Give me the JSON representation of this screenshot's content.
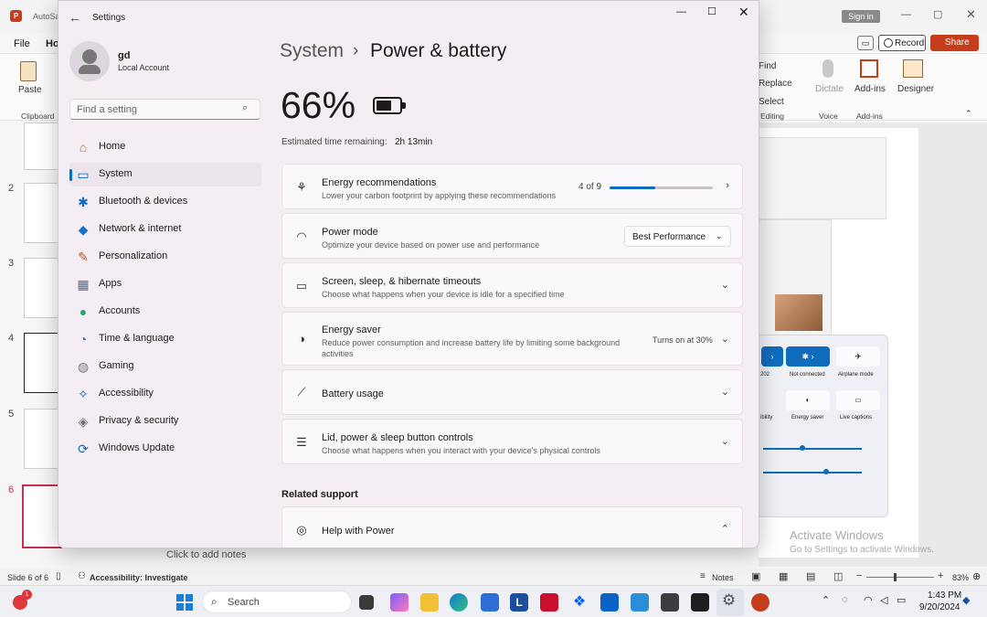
{
  "ppt": {
    "title_small": "AutoSave",
    "signin": "Sign in",
    "record": "Record",
    "share": "Share",
    "menu_file": "File",
    "menu_home": "Ho",
    "paste": "Paste",
    "clipboard": "Clipboard",
    "find": "Find",
    "replace": "Replace",
    "select": "Select",
    "editing": "Editing",
    "dictate": "Dictate",
    "voice": "Voice",
    "addins": "Add-ins",
    "addins_grp": "Add-ins",
    "designer": "Designer",
    "slide_numbers": [
      "2",
      "3",
      "4",
      "5",
      "6"
    ],
    "notes_placeholder": "Click to add notes",
    "status_slide": "Slide 6 of 6",
    "status_access": "Accessibility: Investigate",
    "notes_btn": "Notes",
    "zoom": "83%",
    "activate_title": "Activate Windows",
    "activate_sub": "Go to Settings to activate Windows.",
    "qs": {
      "not_connected": "Not connected",
      "airplane": "Airplane mode",
      "energy_saver": "Energy saver",
      "live_captions": "Live captions",
      "ibility": "ibility",
      "n202": "202"
    }
  },
  "taskbar": {
    "search": "Search",
    "time": "1:43 PM",
    "date": "9/20/2024",
    "badge": "1"
  },
  "settings": {
    "window_title": "Settings",
    "user_name": "gd",
    "user_type": "Local Account",
    "search_placeholder": "Find a setting",
    "nav": [
      {
        "label": "Home",
        "icon": "⌂",
        "color": "#c06a2b"
      },
      {
        "label": "System",
        "icon": "▭",
        "color": "#0f6cbd"
      },
      {
        "label": "Bluetooth & devices",
        "icon": "✱",
        "color": "#0f6cbd"
      },
      {
        "label": "Network & internet",
        "icon": "◆",
        "color": "#1a73c9"
      },
      {
        "label": "Personalization",
        "icon": "✎",
        "color": "#b05a1a"
      },
      {
        "label": "Apps",
        "icon": "▦",
        "color": "#4a6a8c"
      },
      {
        "label": "Accounts",
        "icon": "●",
        "color": "#2aa36b"
      },
      {
        "label": "Time & language",
        "icon": "◔",
        "color": "#1f7fc7"
      },
      {
        "label": "Gaming",
        "icon": "◍",
        "color": "#777777"
      },
      {
        "label": "Accessibility",
        "icon": "✧",
        "color": "#0f6cbd"
      },
      {
        "label": "Privacy & security",
        "icon": "◈",
        "color": "#707070"
      },
      {
        "label": "Windows Update",
        "icon": "⟳",
        "color": "#0f6cbd"
      }
    ],
    "breadcrumb_parent": "System",
    "breadcrumb_sep": "›",
    "page_title": "Power & battery",
    "battery_percent": "66%",
    "battery_level": 0.66,
    "estimated_label": "Estimated time remaining:",
    "estimated_value": "2h 13min",
    "cards": {
      "energy_rec": {
        "title": "Energy recommendations",
        "desc": "Lower your carbon footprint by applying these recommendations",
        "count": "4 of 9",
        "progress": 0.44
      },
      "power_mode": {
        "title": "Power mode",
        "desc": "Optimize your device based on power use and performance",
        "value": "Best Performance"
      },
      "screen_sleep": {
        "title": "Screen, sleep, & hibernate timeouts",
        "desc": "Choose what happens when your device is idle for a specified time"
      },
      "energy_saver": {
        "title": "Energy saver",
        "desc": "Reduce power consumption and increase battery life by limiting some background activities",
        "value": "Turns on at 30%"
      },
      "battery_usage": {
        "title": "Battery usage"
      },
      "lid_power": {
        "title": "Lid, power & sleep button controls",
        "desc": "Choose what happens when you interact with your device's physical controls"
      }
    },
    "related_support": "Related support",
    "help_power": "Help with Power"
  }
}
